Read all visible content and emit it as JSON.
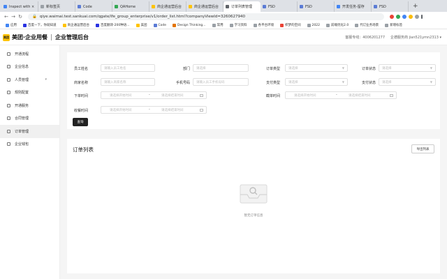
{
  "browser": {
    "tabs": [
      {
        "label": "Inspect with ×",
        "color": "#4285f4"
      },
      {
        "label": "新标签页",
        "color": "#9aa0a6"
      },
      {
        "label": "Code",
        "color": "#5b7bd5"
      },
      {
        "label": "QAHome",
        "color": "#34a853"
      },
      {
        "label": "商企通运营后台",
        "color": "#ffc300"
      },
      {
        "label": "商企通运营后台",
        "color": "#ffc300"
      },
      {
        "label": "订单列表管理",
        "color": "#5f6368",
        "active": true
      },
      {
        "label": "FSD",
        "color": "#5b7bd5"
      },
      {
        "label": "FSD",
        "color": "#5b7bd5"
      },
      {
        "label": "开发任务-留存",
        "color": "#4285f4"
      },
      {
        "label": "FSD",
        "color": "#5b7bd5"
      }
    ],
    "new_tab": "+",
    "url": "qiye.waimai.test.sankuai.com/qgate/lfe_group_enterprise/v1/order_list.html?companyViewId=3260627940",
    "bookmarks": [
      {
        "label": "应用",
        "color": "#4285f4"
      },
      {
        "label": "百度一下，你就知道",
        "color": "#2932e1"
      },
      {
        "label": "商企通运营后台",
        "color": "#ffc300"
      },
      {
        "label": "百度翻译-200种语...",
        "color": "#2932e1"
      },
      {
        "label": "美团",
        "color": "#ffc300"
      },
      {
        "label": "Code",
        "color": "#5b7bd5"
      },
      {
        "label": "Design Thinking...",
        "color": "#e37400"
      },
      {
        "label": "常用",
        "color": "#9aa0a6"
      },
      {
        "label": "学习资料",
        "color": "#9aa0a6"
      },
      {
        "label": "各平台环境",
        "color": "#9aa0a6"
      },
      {
        "label": "织梦的空间",
        "color": "#ea4335"
      },
      {
        "label": "2022",
        "color": "#9aa0a6"
      },
      {
        "label": "前端优化2.0",
        "color": "#9aa0a6"
      },
      {
        "label": "代订业务场景",
        "color": "#9aa0a6"
      },
      {
        "label": "新增标签",
        "color": "#9aa0a6"
      }
    ]
  },
  "app": {
    "logo_badge": "美团",
    "brand": "美团·企业用餐",
    "title": "企业管理后台",
    "hotline": "客服专线：4006201277",
    "user": "企德服务商 jian521ymn2313 ▾"
  },
  "sidebar": [
    {
      "label": "开通流程"
    },
    {
      "label": "企业信息"
    },
    {
      "label": "人员管理",
      "caret": "▾"
    },
    {
      "label": "规则配置"
    },
    {
      "label": "开通服务"
    },
    {
      "label": "合同管理"
    },
    {
      "label": "订单管理",
      "active": true
    },
    {
      "label": "企业钱包"
    }
  ],
  "filters": {
    "employee_name": {
      "label": "员工姓名",
      "placeholder": "请输入员工姓名"
    },
    "department": {
      "label": "部门",
      "placeholder": "请选择"
    },
    "order_type": {
      "label": "订单类型",
      "placeholder": "请选择"
    },
    "order_status": {
      "label": "订单状态",
      "placeholder": "请选择"
    },
    "merchant_name": {
      "label": "商家名称",
      "placeholder": "请输入商家名称"
    },
    "phone": {
      "label": "手机号码",
      "placeholder": "请输入员工手机号码"
    },
    "pay_type": {
      "label": "支付类型",
      "placeholder": "请选择"
    },
    "pay_status": {
      "label": "支付状态",
      "placeholder": "请选择"
    },
    "order_time": {
      "label": "下单时间",
      "start": "请选择开始时间",
      "end": "请选择结束时间"
    },
    "cutoff_time": {
      "label": "截单时间",
      "start": "请选择开始时间",
      "end": "请选择结束时间"
    },
    "receive_time": {
      "label": "收餐时间",
      "start": "请选择开始时间",
      "end": "请选择结束时间"
    },
    "range_sep": "-",
    "query_button": "查询"
  },
  "orders": {
    "title": "订单列表",
    "export_button": "导出列表",
    "empty_text": "暂无订单信息"
  }
}
